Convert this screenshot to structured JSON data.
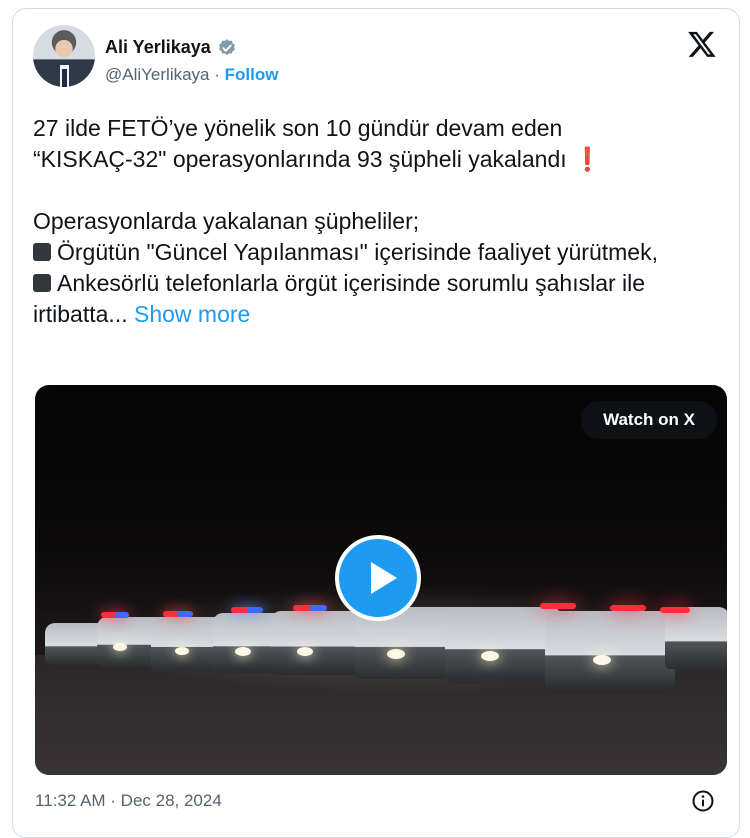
{
  "author": {
    "name": "Ali Yerlikaya",
    "handle": "@AliYerlikaya",
    "separator": "·",
    "follow_label": "Follow",
    "verified": true
  },
  "tweet": {
    "line1": "27 ilde FETÖ’ye yönelik son 10 gündür devam eden",
    "line2": "“KISKAÇ-32\" operasyonlarında 93 şüpheli yakalandı",
    "line2_emoji": "❗",
    "line3": "Operasyonlarda yakalanan şüpheliler;",
    "bullet1": "Örgütün \"Güncel Yapılanması\" içerisinde faaliyet yürütmek,",
    "bullet2": "Ankesörlü telefonlarla örgüt içerisinde sorumlu şahıslar ile irtibatta...",
    "show_more": "Show more"
  },
  "video": {
    "watch_label": "Watch on X",
    "play_icon": "play-icon"
  },
  "footer": {
    "timestamp": "11:32 AM · Dec 28, 2024"
  },
  "icons": {
    "brand": "x-logo-icon",
    "verified": "verified-badge-icon",
    "info": "info-icon"
  },
  "colors": {
    "accent": "#1d9bf0",
    "muted": "#536471",
    "text": "#0f1419",
    "border": "#cfd9de"
  }
}
